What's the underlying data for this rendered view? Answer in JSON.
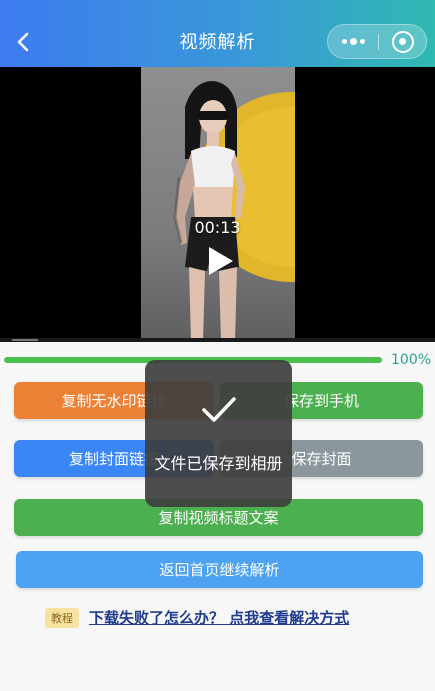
{
  "header": {
    "title": "视频解析",
    "back_icon": "chevron-left-icon",
    "more_icon": "more-dots-icon",
    "close_icon": "target-close-icon"
  },
  "video": {
    "duration": "00:13",
    "play_icon": "play-icon"
  },
  "progress": {
    "value": 1.0,
    "label": "100%"
  },
  "buttons": {
    "copy_no_watermark": "复制无水印链接",
    "save_to_phone": "保存到手机",
    "copy_cover_link": "复制封面链接",
    "save_cover": "保存封面",
    "copy_title": "复制视频标题文案",
    "back_home": "返回首页继续解析"
  },
  "help": {
    "badge": "教程",
    "link": "下载失败了怎么办？ 点我查看解决方式"
  },
  "toast": {
    "text": "文件已保存到相册",
    "icon": "checkmark-icon"
  },
  "colors": {
    "orange": "#ec8135",
    "green": "#4caf50",
    "blue": "#3a86f5",
    "gray": "#8c979d",
    "light_blue": "#4da3f2"
  }
}
